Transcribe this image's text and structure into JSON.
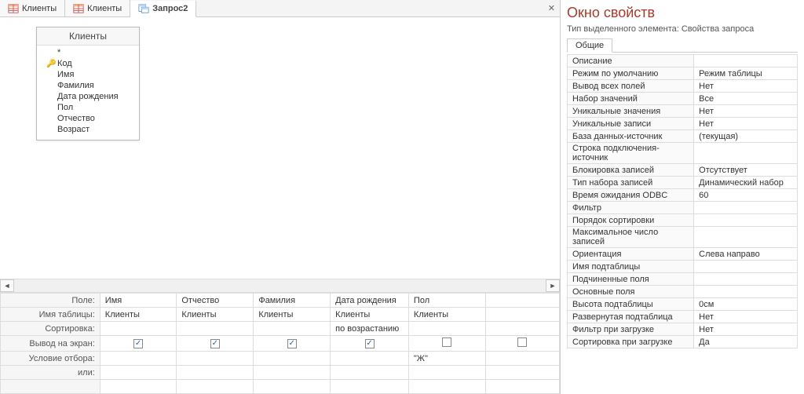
{
  "tabs": [
    {
      "label": "Клиенты",
      "type": "table"
    },
    {
      "label": "Клиенты",
      "type": "table"
    },
    {
      "label": "Запрос2",
      "type": "query",
      "active": true
    }
  ],
  "source_table": {
    "title": "Клиенты",
    "star": "*",
    "fields": [
      {
        "name": "Код",
        "pk": true
      },
      {
        "name": "Имя"
      },
      {
        "name": "Фамилия"
      },
      {
        "name": "Дата рождения"
      },
      {
        "name": "Пол"
      },
      {
        "name": "Отчество"
      },
      {
        "name": "Возраст"
      }
    ]
  },
  "grid_labels": {
    "field": "Поле:",
    "table": "Имя таблицы:",
    "sort": "Сортировка:",
    "show": "Вывод на экран:",
    "criteria": "Условие отбора:",
    "or": "или:"
  },
  "grid_columns": [
    {
      "field": "Имя",
      "table": "Клиенты",
      "sort": "",
      "show": true,
      "criteria": "",
      "or": ""
    },
    {
      "field": "Отчество",
      "table": "Клиенты",
      "sort": "",
      "show": true,
      "criteria": "",
      "or": ""
    },
    {
      "field": "Фамилия",
      "table": "Клиенты",
      "sort": "",
      "show": true,
      "criteria": "",
      "or": ""
    },
    {
      "field": "Дата рождения",
      "table": "Клиенты",
      "sort": "по возрастанию",
      "show": true,
      "criteria": "",
      "or": ""
    },
    {
      "field": "Пол",
      "table": "Клиенты",
      "sort": "",
      "show": false,
      "criteria": "\"Ж\"",
      "or": ""
    },
    {
      "field": "",
      "table": "",
      "sort": "",
      "show": false,
      "criteria": "",
      "or": ""
    }
  ],
  "side": {
    "title": "Окно свойств",
    "subtitle": "Тип выделенного элемента:  Свойства запроса",
    "tab": "Общие",
    "rows": [
      {
        "name": "Описание",
        "value": ""
      },
      {
        "name": "Режим по умолчанию",
        "value": "Режим таблицы"
      },
      {
        "name": "Вывод всех полей",
        "value": "Нет"
      },
      {
        "name": "Набор значений",
        "value": "Все"
      },
      {
        "name": "Уникальные значения",
        "value": "Нет"
      },
      {
        "name": "Уникальные записи",
        "value": "Нет"
      },
      {
        "name": "База данных-источник",
        "value": "(текущая)"
      },
      {
        "name": "Строка подключения-источник",
        "value": ""
      },
      {
        "name": "Блокировка записей",
        "value": "Отсутствует"
      },
      {
        "name": "Тип набора записей",
        "value": "Динамический набор"
      },
      {
        "name": "Время ожидания ODBC",
        "value": "60"
      },
      {
        "name": "Фильтр",
        "value": ""
      },
      {
        "name": "Порядок сортировки",
        "value": ""
      },
      {
        "name": "Максимальное число записей",
        "value": ""
      },
      {
        "name": "Ориентация",
        "value": "Слева направо"
      },
      {
        "name": "Имя подтаблицы",
        "value": ""
      },
      {
        "name": "Подчиненные поля",
        "value": ""
      },
      {
        "name": "Основные поля",
        "value": ""
      },
      {
        "name": "Высота подтаблицы",
        "value": "0см"
      },
      {
        "name": "Развернутая подтаблица",
        "value": "Нет"
      },
      {
        "name": "Фильтр при загрузке",
        "value": "Нет"
      },
      {
        "name": "Сортировка при загрузке",
        "value": "Да"
      }
    ]
  }
}
